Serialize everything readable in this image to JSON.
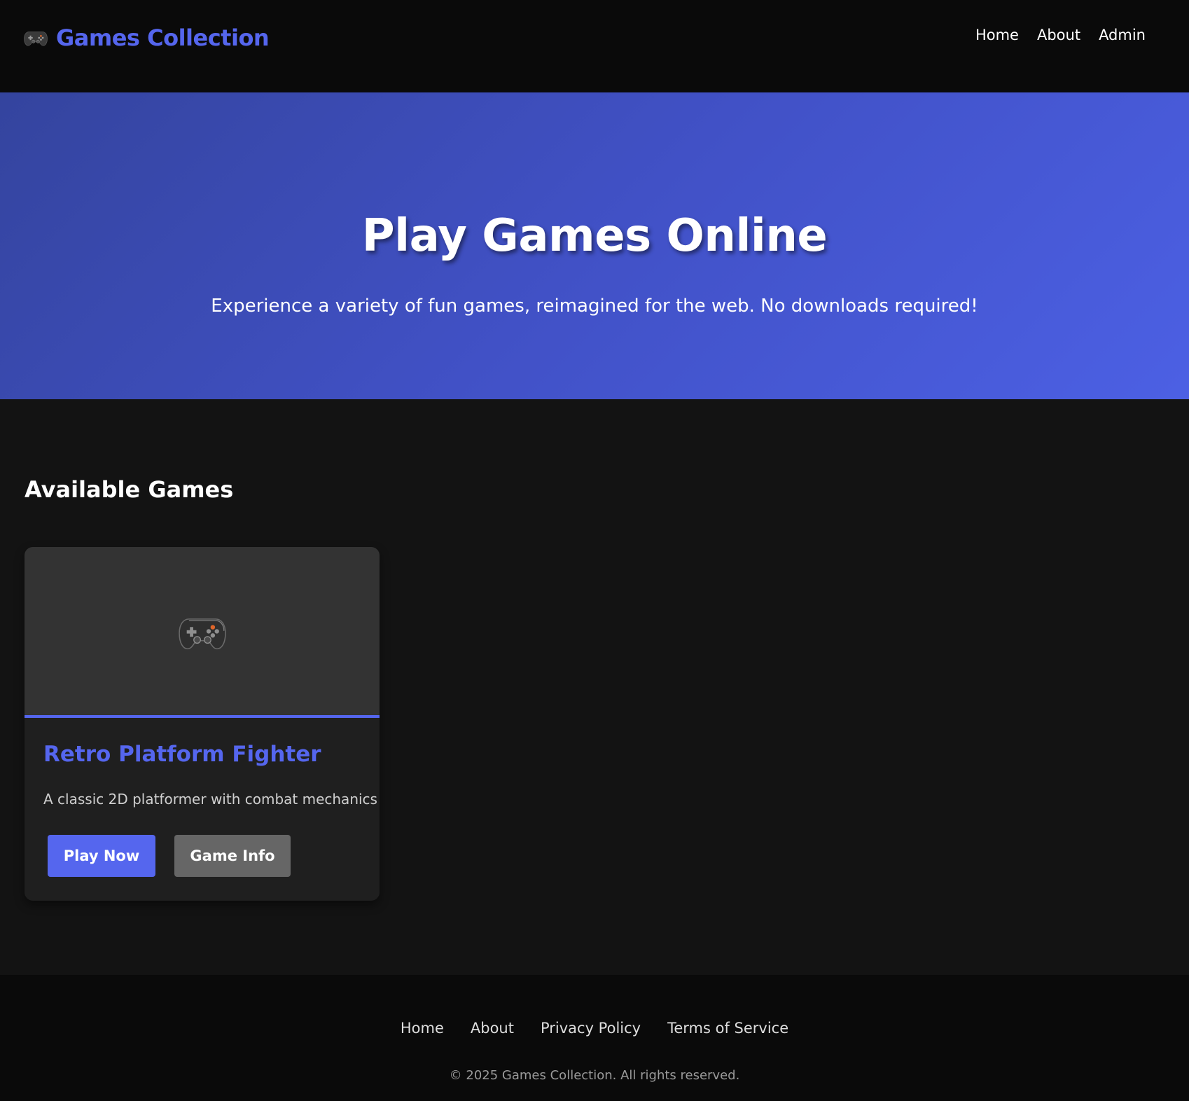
{
  "header": {
    "brand_icon": "gamepad-icon",
    "brand_title": "Games Collection",
    "nav": [
      {
        "label": "Home"
      },
      {
        "label": "About"
      },
      {
        "label": "Admin"
      }
    ]
  },
  "hero": {
    "title": "Play Games Online",
    "subtitle": "Experience a variety of fun games, reimagined for the web. No downloads required!"
  },
  "main": {
    "section_title": "Available Games",
    "games": [
      {
        "thumbnail_icon": "gamepad-icon",
        "title": "Retro Platform Fighter",
        "description": "A classic 2D platformer with combat mechanics",
        "play_label": "Play Now",
        "info_label": "Game Info"
      }
    ]
  },
  "footer": {
    "links": [
      {
        "label": "Home"
      },
      {
        "label": "About"
      },
      {
        "label": "Privacy Policy"
      },
      {
        "label": "Terms of Service"
      }
    ],
    "copyright": "© 2025 Games Collection. All rights reserved."
  },
  "colors": {
    "accent": "#5566ee",
    "background": "#131313",
    "header_bg": "#0a0a0a",
    "card_bg": "#1f1f1f",
    "secondary_button": "#666666"
  }
}
